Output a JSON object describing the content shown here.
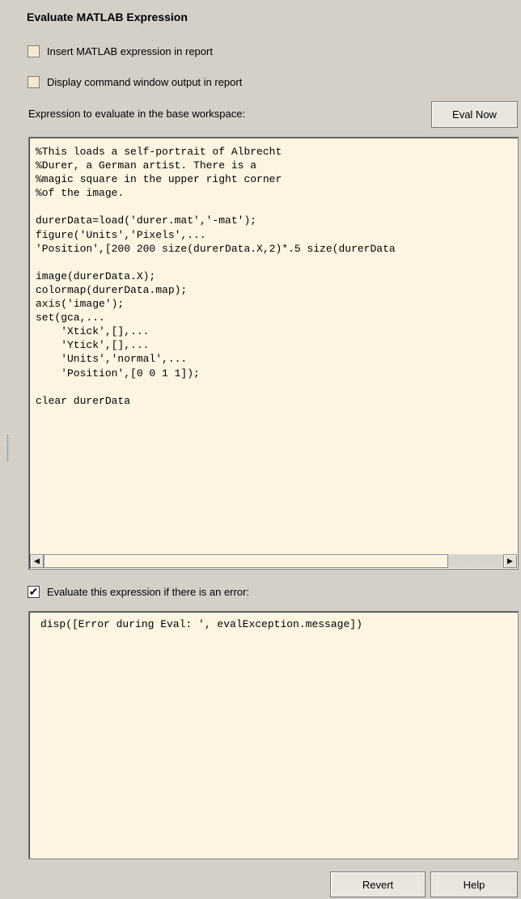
{
  "panel": {
    "title": "Evaluate MATLAB Expression"
  },
  "options": {
    "insert_expression": {
      "label": "Insert MATLAB expression in report",
      "checked": false
    },
    "display_output": {
      "label": "Display command window output in report",
      "checked": false
    }
  },
  "expression": {
    "label": "Expression to evaluate in the base workspace:",
    "eval_now_label": "Eval Now",
    "code": "%This loads a self-portrait of Albrecht\n%Durer, a German artist. There is a\n%magic square in the upper right corner\n%of the image.\n\ndurerData=load('durer.mat','-mat');\nfigure('Units','Pixels',...\n'Position',[200 200 size(durerData.X,2)*.5 size(durerData\n\nimage(durerData.X);\ncolormap(durerData.map);\naxis('image');\nset(gca,...\n    'Xtick',[],...\n    'Ytick',[],...\n    'Units','normal',...\n    'Position',[0 0 1 1]);\n\nclear durerData"
  },
  "error_handling": {
    "label": "Evaluate this expression if there is an error:",
    "checked": true,
    "code": "disp([Error during Eval: ', evalException.message])"
  },
  "footer": {
    "revert_label": "Revert",
    "help_label": "Help"
  },
  "colors": {
    "panel_bg": "#d4d0c8",
    "editor_bg": "#fdf5e2"
  }
}
